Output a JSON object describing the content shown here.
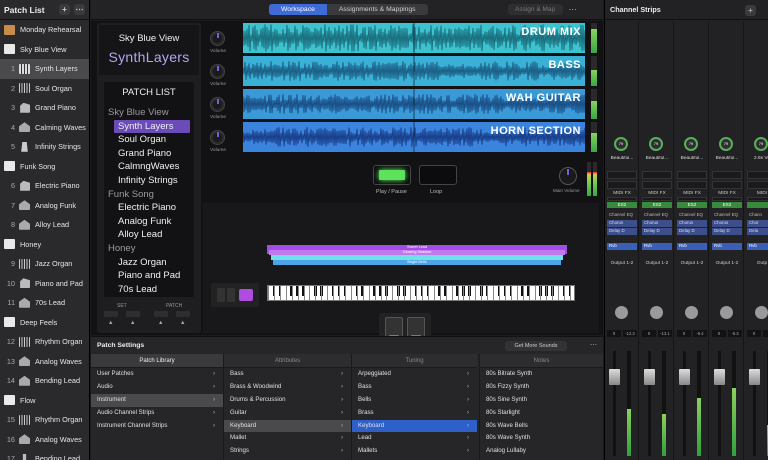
{
  "patch_list": {
    "title": "Patch List",
    "add_label": "+",
    "menu_label": "⋯",
    "rows": [
      {
        "type": "folder",
        "label": "Monday Rehearsal",
        "icon": "set-folder-icon",
        "brown": true
      },
      {
        "type": "folder",
        "label": "Sky Blue View",
        "icon": "folder-icon"
      },
      {
        "type": "patch",
        "num": "1",
        "label": "Synth Layers",
        "icon": "keyboard-icon",
        "selected": true
      },
      {
        "type": "patch",
        "num": "2",
        "label": "Soul Organ",
        "icon": "organ-icon"
      },
      {
        "type": "patch",
        "num": "3",
        "label": "Grand Piano",
        "icon": "piano-icon"
      },
      {
        "type": "patch",
        "num": "4",
        "label": "Calming Waves",
        "icon": "synth-icon"
      },
      {
        "type": "patch",
        "num": "5",
        "label": "Infinity Strings",
        "icon": "strings-icon"
      },
      {
        "type": "folder",
        "label": "Funk Song",
        "icon": "folder-icon"
      },
      {
        "type": "patch",
        "num": "6",
        "label": "Electric Piano",
        "icon": "piano-icon"
      },
      {
        "type": "patch",
        "num": "7",
        "label": "Analog Funk",
        "icon": "synth-icon"
      },
      {
        "type": "patch",
        "num": "8",
        "label": "Alloy Lead",
        "icon": "synth-icon"
      },
      {
        "type": "folder",
        "label": "Honey",
        "icon": "folder-icon"
      },
      {
        "type": "patch",
        "num": "9",
        "label": "Jazz Organ",
        "icon": "organ-icon"
      },
      {
        "type": "patch",
        "num": "10",
        "label": "Piano and Pad",
        "icon": "piano-icon"
      },
      {
        "type": "patch",
        "num": "11",
        "label": "70s Lead",
        "icon": "synth-icon"
      },
      {
        "type": "folder",
        "label": "Deep Feels",
        "icon": "folder-icon"
      },
      {
        "type": "patch",
        "num": "12",
        "label": "Rhythm Organ",
        "icon": "organ-icon"
      },
      {
        "type": "patch",
        "num": "13",
        "label": "Analog Waves",
        "icon": "synth-icon"
      },
      {
        "type": "patch",
        "num": "14",
        "label": "Bending Lead",
        "icon": "synth-icon"
      },
      {
        "type": "folder",
        "label": "Flow",
        "icon": "folder-icon"
      },
      {
        "type": "patch",
        "num": "15",
        "label": "Rhythm Organ",
        "icon": "organ-icon"
      },
      {
        "type": "patch",
        "num": "16",
        "label": "Analog Waves",
        "icon": "synth-icon"
      },
      {
        "type": "patch",
        "num": "17",
        "label": "Bending Lead",
        "icon": "mic-icon"
      }
    ]
  },
  "topbar": {
    "tabs": [
      {
        "label": "Workspace",
        "active": true
      },
      {
        "label": "Assignments & Mappings",
        "active": false
      }
    ],
    "assign_label": "Assign & Map",
    "more_label": "⋯"
  },
  "workspace": {
    "set_name": "Sky Blue View",
    "patch_name": "SynthLayers",
    "patch_list_title": "PATCH LIST",
    "patch_list": [
      {
        "label": "Sky Blue View",
        "cat": true
      },
      {
        "label": "Synth Layers",
        "selected": true
      },
      {
        "label": "Soul Organ"
      },
      {
        "label": "Grand Piano"
      },
      {
        "label": "CalmngWaves"
      },
      {
        "label": "Infinity Strings"
      },
      {
        "label": "Funk Song",
        "cat": true
      },
      {
        "label": "Electric Piano"
      },
      {
        "label": "Analog Funk"
      },
      {
        "label": "Alloy Lead"
      },
      {
        "label": "Honey",
        "cat": true
      },
      {
        "label": "Jazz Organ"
      },
      {
        "label": "Piano and Pad"
      },
      {
        "label": "70s Lead"
      }
    ],
    "set_label": "SET",
    "patch_label": "PATCH",
    "arrow_up": "▲",
    "tracks": [
      {
        "name": "DRUM MIX",
        "vol_label": "Volume",
        "color": "#3cc3cf",
        "wave": "#1b6f7e",
        "level": 0.8
      },
      {
        "name": "BASS",
        "vol_label": "Volume",
        "color": "#3ab0d6",
        "wave": "#1c5f86",
        "level": 0.55
      },
      {
        "name": "WAH GUITAR",
        "vol_label": "Volume",
        "color": "#3a9ad8",
        "wave": "#1b4f86",
        "level": 0.6
      },
      {
        "name": "HORN SECTION",
        "vol_label": "Volume",
        "color": "#3a84dd",
        "wave": "#1a3f8a",
        "level": 0.65
      }
    ],
    "play_label": "Play / Pause",
    "loop_label": "Loop",
    "main_volume_label": "Main Volume",
    "layers": [
      {
        "label": "Sweet Lead",
        "color": "#a24de6"
      },
      {
        "label": "Glowing Shadow",
        "color": "#c278f0"
      },
      {
        "label": "",
        "color": "#6fe0ea"
      },
      {
        "label": "Bright Bells",
        "color": "#4aa5e8"
      }
    ]
  },
  "patch_settings": {
    "title": "Patch Settings",
    "more_sounds": "Get More Sounds",
    "menu_label": "⋯",
    "columns": [
      {
        "header": "Patch Library",
        "active": true,
        "rows": [
          {
            "label": "User Patches",
            "chev": true
          },
          {
            "label": "Audio",
            "chev": true
          },
          {
            "label": "Instrument",
            "chev": true,
            "sel": true
          },
          {
            "label": "Audio Channel Strips",
            "chev": true
          },
          {
            "label": "Instrument Channel Strips",
            "chev": true
          }
        ]
      },
      {
        "header": "Attributes",
        "rows": [
          {
            "label": "Bass",
            "chev": true
          },
          {
            "label": "Brass & Woodwind",
            "chev": true
          },
          {
            "label": "Drums & Percussion",
            "chev": true
          },
          {
            "label": "Guitar",
            "chev": true
          },
          {
            "label": "Keyboard",
            "chev": true,
            "sel": true
          },
          {
            "label": "Mallet",
            "chev": true
          },
          {
            "label": "Strings",
            "chev": true
          }
        ]
      },
      {
        "header": "Tuning",
        "rows": [
          {
            "label": "Arpeggiated",
            "chev": true
          },
          {
            "label": "Bass",
            "chev": true
          },
          {
            "label": "Bells",
            "chev": true
          },
          {
            "label": "Brass",
            "chev": true
          },
          {
            "label": "Keyboard",
            "chev": true,
            "sel": true,
            "blue": true
          },
          {
            "label": "Lead",
            "chev": true
          },
          {
            "label": "Mallets",
            "chev": true
          }
        ]
      },
      {
        "header": "Notes",
        "rows": [
          {
            "label": "80s Bitrate Synth"
          },
          {
            "label": "80s Fizzy Synth"
          },
          {
            "label": "80s Sine Synth"
          },
          {
            "label": "80s Starlight"
          },
          {
            "label": "80s Wave Bells"
          },
          {
            "label": "80s Wave Synth"
          },
          {
            "label": "Analog Lullaby"
          }
        ]
      }
    ]
  },
  "channel_strips": {
    "title": "Channel Strips",
    "add_label": "+",
    "strips": [
      {
        "gain": "79",
        "name": "Beautiful...",
        "midi": "MIDI FX",
        "eq": "ES2",
        "fx": [
          "Channel EQ",
          "Chorus",
          "Delay D"
        ],
        "rvb": "Rvb",
        "output": "Output 1-2",
        "pan_l": "0",
        "pan_r": "-12.3",
        "level": 0.45
      },
      {
        "gain": "79",
        "name": "Beautiful...",
        "midi": "MIDI FX",
        "eq": "ES2",
        "fx": [
          "Channel EQ",
          "Chorus",
          "Delay D"
        ],
        "rvb": "Rvb",
        "output": "Output 1-2",
        "pan_l": "0",
        "pan_r": "-13.1",
        "level": 0.4
      },
      {
        "gain": "79",
        "name": "Beautiful...",
        "midi": "MIDI FX",
        "eq": "ES2",
        "fx": [
          "Channel EQ",
          "Chorus",
          "Delay D"
        ],
        "rvb": "Rvb",
        "output": "Output 1-2",
        "pan_l": "0",
        "pan_r": "-9.4",
        "level": 0.55
      },
      {
        "gain": "79",
        "name": "Beautiful...",
        "midi": "MIDI FX",
        "eq": "ES2",
        "fx": [
          "Channel EQ",
          "Chorus",
          "Delay D"
        ],
        "rvb": "Rvb",
        "output": "Output 1-2",
        "pan_l": "0",
        "pan_r": "-6.3",
        "level": 0.65
      },
      {
        "gain": "79",
        "name": "2.6s Vo",
        "midi": "MIDI",
        "eq": "",
        "fx": [
          "Chann",
          "Chor",
          "Dela"
        ],
        "rvb": "Rvb",
        "output": "Outp",
        "pan_l": "0",
        "pan_r": "",
        "level": 0.3
      }
    ],
    "mute_label": "M",
    "solo_label": "S"
  }
}
